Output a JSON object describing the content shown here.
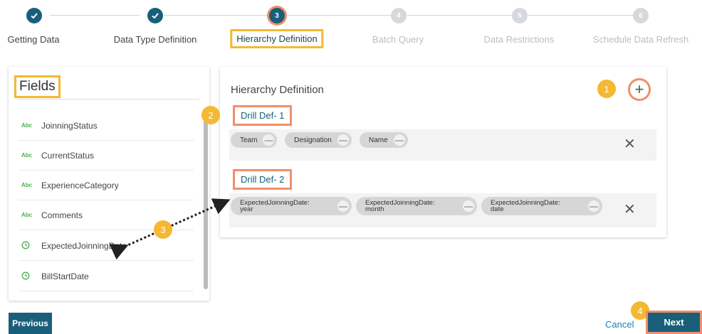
{
  "stepper": {
    "steps": [
      {
        "number": "",
        "label": "Getting Data",
        "state": "done"
      },
      {
        "number": "",
        "label": "Data Type Definition",
        "state": "done"
      },
      {
        "number": "3",
        "label": "Hierarchy Definition",
        "state": "active"
      },
      {
        "number": "4",
        "label": "Batch Query",
        "state": "pending"
      },
      {
        "number": "5",
        "label": "Data Restrictions",
        "state": "pending"
      },
      {
        "number": "6",
        "label": "Schedule Data Refresh",
        "state": "pending"
      }
    ]
  },
  "fields": {
    "title": "Fields",
    "items": [
      {
        "icon": "Abc",
        "type": "text",
        "label": "JoinningStatus"
      },
      {
        "icon": "Abc",
        "type": "text",
        "label": "CurrentStatus"
      },
      {
        "icon": "Abc",
        "type": "text",
        "label": "ExperienceCategory"
      },
      {
        "icon": "Abc",
        "type": "text",
        "label": "Comments"
      },
      {
        "icon": "clock-icon",
        "type": "date",
        "label": "ExpectedJoinningDate"
      },
      {
        "icon": "clock-icon",
        "type": "date",
        "label": "BillStartDate"
      }
    ]
  },
  "hierarchy": {
    "title": "Hierarchy Definition",
    "add_label": "+",
    "drills": [
      {
        "name": "Drill Def- 1",
        "chips": [
          "Team",
          "Designation",
          "Name"
        ]
      },
      {
        "name": "Drill Def- 2",
        "chips": [
          "ExpectedJoinningDate:\nyear",
          "ExpectedJoinningDate:\nmonth",
          "ExpectedJoinningDate:\ndate"
        ]
      }
    ],
    "minus_glyph": "—",
    "close_glyph": "✕"
  },
  "badges": [
    "1",
    "2",
    "3",
    "4"
  ],
  "footer": {
    "previous_label": "Previous",
    "cancel_label": "Cancel",
    "next_label": "Next"
  },
  "colors": {
    "primary": "#1a5f7a",
    "highlight_yellow": "#f5b833",
    "highlight_orange": "#f08f6a",
    "link": "#1a7fb8"
  }
}
